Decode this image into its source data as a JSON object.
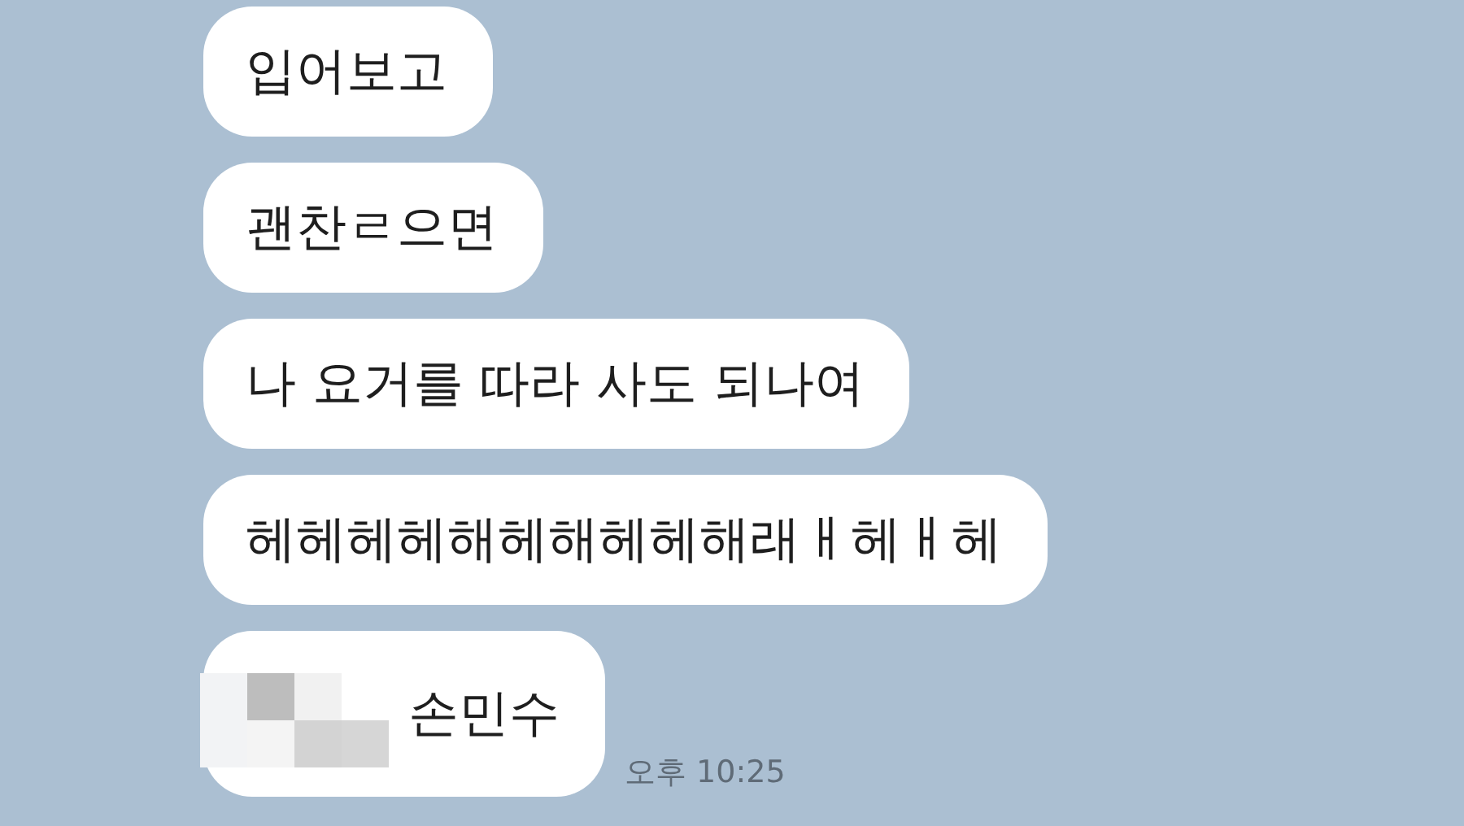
{
  "messages": [
    {
      "kind": "text",
      "text": "입어보고"
    },
    {
      "kind": "text",
      "text": "괜찬ㄹ으면"
    },
    {
      "kind": "text",
      "text": "나 요거를 따라 사도 되나여"
    },
    {
      "kind": "text",
      "text": "헤헤헤헤해헤해헤헤해래ㅐ헤ㅐ헤"
    },
    {
      "kind": "redacted",
      "text": "손민수",
      "time": "오후 10:25"
    }
  ]
}
